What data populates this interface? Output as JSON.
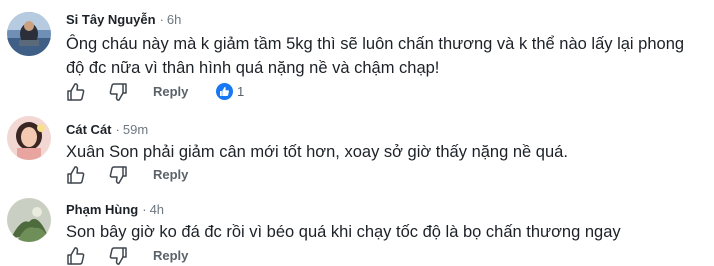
{
  "comments": [
    {
      "author": "Si Tây Nguyễn",
      "separator": "·",
      "time": "6h",
      "text": "Ông cháu này mà k giảm tầm 5kg thì sẽ luôn chấn thương và k thể nào lấy lại phong độ đc nữa vì thân hình quá nặng nề và chậm chạp!",
      "reply_label": "Reply",
      "reactions": {
        "icon": "thumbs-up-badge-icon",
        "count": "1"
      }
    },
    {
      "author": "Cát Cát",
      "separator": "·",
      "time": "59m",
      "text": "Xuân Son phải giảm cân mới tốt hơn, xoay sở giờ thấy nặng nề quá.",
      "reply_label": "Reply"
    },
    {
      "author": "Phạm Hùng",
      "separator": "·",
      "time": "4h",
      "text": "Son bây giờ ko đá đc rồi vì béo quá khi chạy tốc độ là bọ chấn thương ngay",
      "reply_label": "Reply"
    }
  ],
  "icons": {
    "like": "thumbs-up-icon",
    "dislike": "thumbs-down-icon",
    "badge": "thumbs-up-badge-icon"
  },
  "colors": {
    "author": "#1d2228",
    "meta": "#6e7780",
    "action": "#5b636a",
    "reaction_badge": "#1877f2"
  }
}
